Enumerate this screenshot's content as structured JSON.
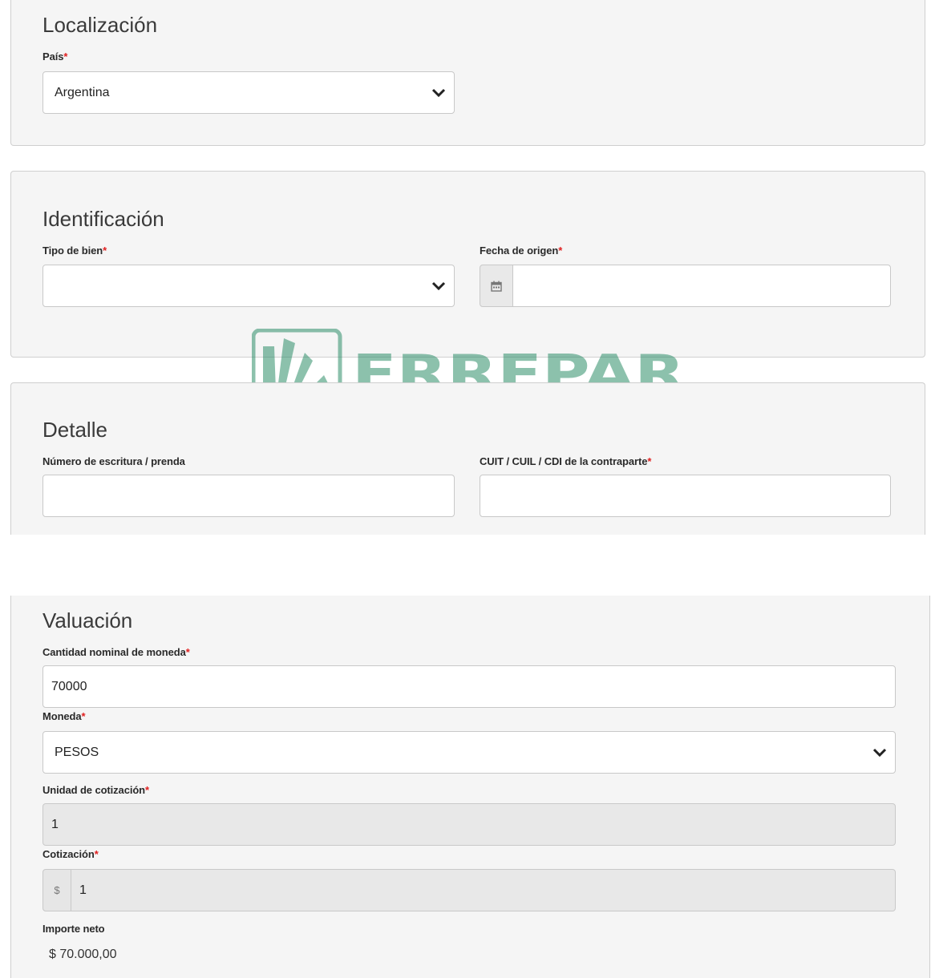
{
  "localizacion": {
    "title": "Localización",
    "pais_label": "País",
    "pais_value": "Argentina"
  },
  "identificacion": {
    "title": "Identificación",
    "tipo_label": "Tipo de bien",
    "tipo_value": "",
    "fecha_label": "Fecha de origen",
    "fecha_value": ""
  },
  "detalle": {
    "title": "Detalle",
    "escritura_label": "Número de escritura / prenda",
    "escritura_value": "",
    "cuit_label": "CUIT / CUIL / CDI de la contraparte",
    "cuit_value": ""
  },
  "valuacion": {
    "title": "Valuación",
    "cantidad_label": "Cantidad nominal de moneda",
    "cantidad_value": "70000",
    "moneda_label": "Moneda",
    "moneda_value": "PESOS",
    "unidad_label": "Unidad de cotización",
    "unidad_value": "1",
    "cotizacion_label": "Cotización",
    "cotizacion_prefix": "$",
    "cotizacion_value": "1",
    "importe_label": "Importe neto",
    "importe_value": "$ 70.000,00"
  },
  "required_marker": "*",
  "watermark_text": "ERREPAR",
  "colors": {
    "required": "#e02020",
    "panel_bg": "#f5f5f5",
    "watermark": "#2f8f6a"
  }
}
